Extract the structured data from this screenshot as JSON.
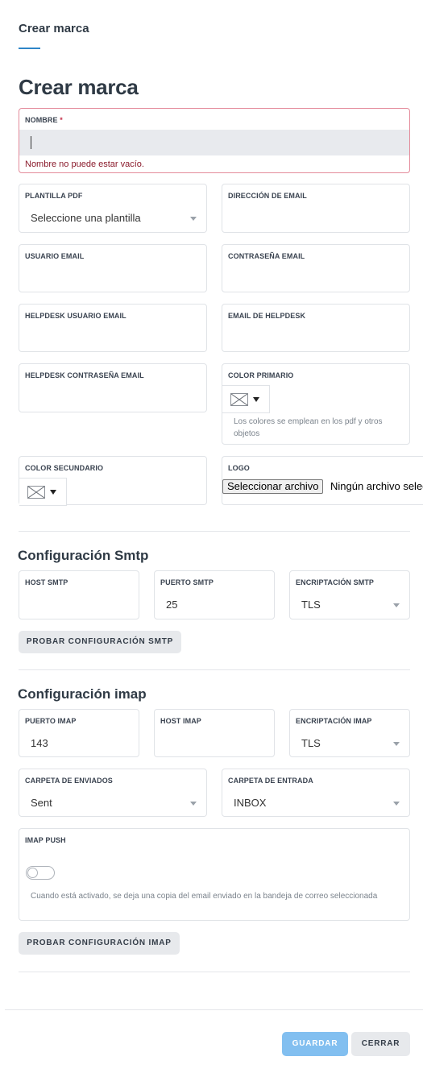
{
  "header": {
    "tab_title": "Crear marca",
    "page_title": "Crear marca"
  },
  "form": {
    "nombre": {
      "label": "NOMBRE",
      "required_mark": "*",
      "value": "",
      "error": "Nombre no puede estar vacío."
    },
    "plantilla_pdf": {
      "label": "PLANTILLA PDF",
      "value": "Seleccione una plantilla"
    },
    "direccion_email": {
      "label": "DIRECCIÓN DE EMAIL",
      "value": ""
    },
    "usuario_email": {
      "label": "USUARIO EMAIL",
      "value": ""
    },
    "contrasena_email": {
      "label": "CONTRASEÑA EMAIL",
      "value": ""
    },
    "helpdesk_usuario_email": {
      "label": "HELPDESK USUARIO EMAIL",
      "value": ""
    },
    "email_helpdesk": {
      "label": "EMAIL DE HELPDESK",
      "value": ""
    },
    "helpdesk_contrasena_email": {
      "label": "HELPDESK CONTRASEÑA EMAIL",
      "value": ""
    },
    "color_primario": {
      "label": "COLOR PRIMARIO",
      "hint": "Los colores se emplean en los pdf y otros objetos"
    },
    "color_secundario": {
      "label": "COLOR SECUNDARIO"
    },
    "logo": {
      "label": "LOGO",
      "button": "Seleccionar archivo",
      "file_status": "Ningún archivo seleccionado"
    }
  },
  "smtp": {
    "title": "Configuración Smtp",
    "host": {
      "label": "HOST SMTP",
      "value": ""
    },
    "puerto": {
      "label": "PUERTO SMTP",
      "value": "25"
    },
    "encriptacion": {
      "label": "ENCRIPTACIÓN SMTP",
      "value": "TLS"
    },
    "test_button": "PROBAR CONFIGURACIÓN SMTP"
  },
  "imap": {
    "title": "Configuración imap",
    "puerto": {
      "label": "PUERTO IMAP",
      "value": "143"
    },
    "host": {
      "label": "HOST IMAP",
      "value": ""
    },
    "encriptacion": {
      "label": "ENCRIPTACIÓN IMAP",
      "value": "TLS"
    },
    "carpeta_enviados": {
      "label": "CARPETA DE ENVIADOS",
      "value": "Sent"
    },
    "carpeta_entrada": {
      "label": "CARPETA DE ENTRADA",
      "value": "INBOX"
    },
    "push": {
      "label": "IMAP PUSH",
      "enabled": false,
      "hint": "Cuando está activado, se deja una copia del email enviado en la bandeja de correo seleccionada"
    },
    "test_button": "PROBAR CONFIGURACIÓN IMAP"
  },
  "footer": {
    "save_label": "GUARDAR",
    "close_label": "CERRAR"
  },
  "colors": {
    "accent": "#2f86c8",
    "error": "#c4314b",
    "save_button": "#82bff0"
  }
}
